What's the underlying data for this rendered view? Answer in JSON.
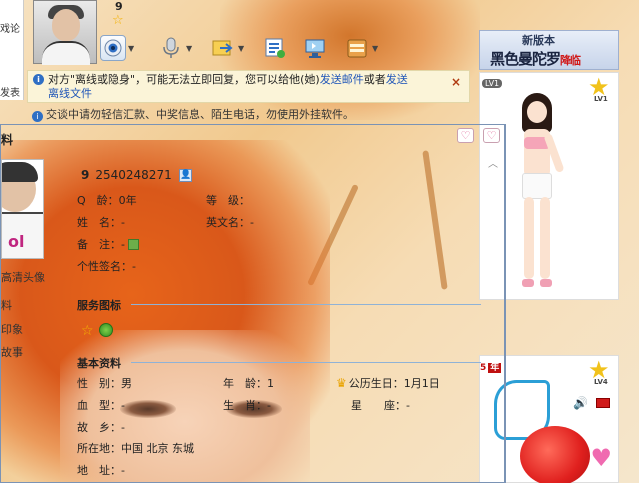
{
  "toolbar": {
    "user_name": "9",
    "ad_line1": "新版本",
    "ad_line2": "黑色曼陀罗",
    "ad_line2_suffix": "降临",
    "icons": [
      "star-icon",
      "camera-icon",
      "microphone-icon",
      "transfer-file-icon",
      "message-record-icon",
      "remote-assist-icon",
      "app-box-icon"
    ]
  },
  "left_strip": {
    "tab1": "",
    "tab2": "戏论",
    "send": "发表"
  },
  "info": {
    "line1_prefix": "对方\"离线或隐身\"，可能无法立即回复，您可以给他(她)",
    "link_email": "发送邮件",
    "line1_mid": "或者",
    "link_offline": "发送",
    "line2": "离线文件",
    "close": "×",
    "line_2": "交谈中请勿轻信汇款、中奖信息、陌生电话，勿使用外挂软件。"
  },
  "show": {
    "lv_badge": "LV1",
    "lv1": "LV1",
    "lv4": "LV4",
    "year_text": "5",
    "year_char": "年"
  },
  "profile": {
    "title": "料",
    "hd_avatar": "高清头像",
    "link1": "料",
    "link2": "印象",
    "link3": "故事",
    "uid_name": "9",
    "uid_number": "2540248271",
    "fields_top": [
      {
        "label": "Q　龄：",
        "value": "0年"
      },
      {
        "label": "等　级：",
        "value": ""
      },
      {
        "label": "姓　名：",
        "value": "-"
      },
      {
        "label": "英文名：",
        "value": "-"
      },
      {
        "label": "备　注：",
        "value": "-"
      },
      {
        "label": "个性签名：",
        "value": "-"
      }
    ],
    "section_service": "服务图标",
    "section_basic": "基本资料",
    "basic": [
      {
        "label": "性　别：",
        "value": "男"
      },
      {
        "label": "年　龄：",
        "value": "1"
      },
      {
        "label": "公历生日：",
        "value": "1月1日"
      },
      {
        "label": "血　型：",
        "value": "-"
      },
      {
        "label": "生　肖：",
        "value": "-"
      },
      {
        "label": "星　　座：",
        "value": "-"
      },
      {
        "label": "故　乡：",
        "value": "-"
      },
      {
        "label": "所在地：",
        "value": "中国 北京 东城"
      },
      {
        "label": "地　址：",
        "value": "-"
      }
    ]
  },
  "colors": {
    "link": "#1f55b8",
    "info_bg": "#fbf4d8",
    "panel_border": "#7a93b5",
    "section_line": "#8fb2d6"
  }
}
